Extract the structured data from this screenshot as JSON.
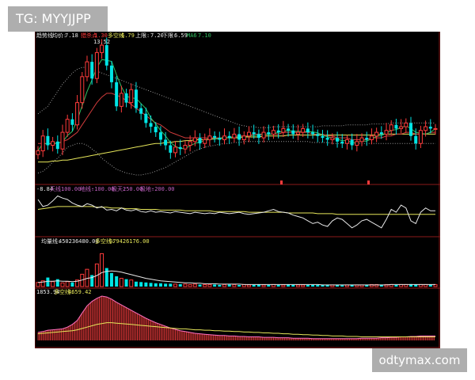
{
  "watermark_top": "TG: MYYJJPP",
  "watermark_bottom": "odtymax.com",
  "colors": {
    "up": "#ff3b3b",
    "down": "#00e5e5",
    "ma_white": "#e8e8e8",
    "ma_yellow": "#e6e65a",
    "ma_red": "#d23c3c",
    "ma_green": "#2fbf60",
    "dotted": "#9a9a9a",
    "grid_red": "#8b1a1a",
    "purple": "#c060c0",
    "orange": "#ffa500",
    "pink": "#ff70c0"
  },
  "chart_data": [
    {
      "type": "candlestick",
      "legend": {
        "title": "趋势线",
        "avg_label": "均价:",
        "avg_value": "7.18",
        "red_label": "猎杀点",
        "red_value": "1.30",
        "ls_label": "多空线",
        "ls_value": "6.79",
        "up_label": "上限:",
        "up_value": "7.20",
        "down_label": "下限:",
        "down_value": "6.59",
        "ma_label": "MA6",
        "ma_value": "7.10"
      },
      "peak_label": "13.52",
      "prices": [
        7.6,
        8.4,
        7.9,
        8.1,
        7.7,
        8.6,
        9.3,
        9.0,
        10.2,
        11.6,
        12.4,
        11.5,
        12.9,
        13.3,
        12.2,
        11.3,
        10.0,
        10.7,
        10.2,
        10.9,
        9.9,
        9.6,
        9.1,
        8.9,
        8.6,
        8.2,
        7.9,
        7.5,
        7.8,
        7.7,
        7.9,
        8.1,
        8.3,
        8.0,
        8.2,
        8.4,
        8.3,
        8.2,
        8.4,
        8.3,
        8.5,
        8.2,
        8.4,
        8.6,
        8.5,
        8.3,
        8.6,
        8.5,
        8.7,
        8.6,
        8.8,
        8.7,
        8.5,
        8.6,
        8.8,
        8.6,
        8.5,
        8.4,
        8.3,
        8.2,
        8.3,
        8.1,
        8.0,
        8.2,
        7.9,
        8.1,
        8.3,
        8.2,
        8.4,
        8.6,
        8.5,
        8.7,
        9.0,
        8.8,
        8.9,
        9.1,
        8.4,
        8.0,
        8.7,
        8.9,
        8.8,
        8.8
      ],
      "ma_red": [
        8.0,
        8.0,
        8.0,
        8.0,
        8.0,
        8.1,
        8.2,
        8.4,
        8.6,
        9.0,
        9.4,
        9.8,
        10.2,
        10.5,
        10.7,
        10.7,
        10.6,
        10.5,
        10.3,
        10.1,
        9.9,
        9.7,
        9.5,
        9.3,
        9.1,
        9.0,
        8.8,
        8.6,
        8.5,
        8.4,
        8.3,
        8.3,
        8.3,
        8.3,
        8.3,
        8.3,
        8.3,
        8.3,
        8.3,
        8.3,
        8.4,
        8.4,
        8.4,
        8.4,
        8.5,
        8.5,
        8.5,
        8.5,
        8.5,
        8.5,
        8.6,
        8.6,
        8.6,
        8.6,
        8.6,
        8.6,
        8.5,
        8.5,
        8.5,
        8.4,
        8.4,
        8.3,
        8.3,
        8.3,
        8.2,
        8.2,
        8.2,
        8.2,
        8.3,
        8.3,
        8.3,
        8.4,
        8.4,
        8.5,
        8.5,
        8.6,
        8.6,
        8.5,
        8.5,
        8.5,
        8.6,
        8.6
      ],
      "ma_yellow": [
        7.0,
        7.0,
        7.0,
        7.05,
        7.05,
        7.1,
        7.1,
        7.15,
        7.2,
        7.25,
        7.3,
        7.35,
        7.4,
        7.45,
        7.5,
        7.55,
        7.6,
        7.65,
        7.7,
        7.75,
        7.8,
        7.85,
        7.9,
        7.95,
        8.0,
        8.0,
        8.05,
        8.05,
        8.1,
        8.1,
        8.15,
        8.15,
        8.2,
        8.2,
        8.2,
        8.25,
        8.25,
        8.25,
        8.3,
        8.3,
        8.3,
        8.3,
        8.35,
        8.35,
        8.35,
        8.35,
        8.4,
        8.4,
        8.4,
        8.4,
        8.4,
        8.45,
        8.45,
        8.45,
        8.45,
        8.45,
        8.45,
        8.45,
        8.45,
        8.45,
        8.45,
        8.45,
        8.45,
        8.45,
        8.45,
        8.45,
        8.45,
        8.45,
        8.45,
        8.45,
        8.5,
        8.5,
        8.5,
        8.5,
        8.5,
        8.5,
        8.5,
        8.5,
        8.5,
        8.5,
        8.5,
        8.5
      ],
      "band_upper": [
        9.6,
        9.8,
        10.0,
        10.4,
        10.8,
        11.2,
        11.5,
        11.8,
        12.0,
        12.1,
        12.1,
        12.0,
        11.9,
        11.8,
        11.7,
        11.6,
        11.5,
        11.4,
        11.3,
        11.2,
        11.1,
        11.0,
        10.9,
        10.8,
        10.7,
        10.6,
        10.5,
        10.4,
        10.3,
        10.2,
        10.1,
        10.0,
        9.9,
        9.8,
        9.7,
        9.6,
        9.5,
        9.4,
        9.3,
        9.2,
        9.1,
        9.0,
        8.95,
        8.9,
        8.9,
        8.85,
        8.85,
        8.85,
        8.9,
        8.9,
        8.9,
        8.9,
        8.9,
        8.9,
        8.9,
        8.9,
        8.9,
        8.9,
        8.95,
        8.95,
        8.95,
        8.95,
        8.95,
        9.0,
        9.0,
        9.0,
        9.0,
        9.0,
        9.05,
        9.05,
        9.05,
        9.05,
        9.1,
        9.1,
        9.1,
        9.1,
        9.1,
        9.1,
        9.1,
        9.1,
        9.1,
        9.1
      ],
      "band_lower": [
        6.4,
        6.5,
        6.7,
        7.0,
        7.2,
        7.5,
        7.8,
        7.9,
        8.0,
        8.0,
        7.9,
        7.7,
        7.5,
        7.2,
        7.0,
        6.8,
        6.6,
        6.5,
        6.4,
        6.35,
        6.3,
        6.3,
        6.35,
        6.4,
        6.5,
        6.6,
        6.7,
        6.85,
        7.0,
        7.15,
        7.3,
        7.45,
        7.6,
        7.7,
        7.8,
        7.85,
        7.9,
        7.95,
        8.0,
        8.0,
        8.05,
        8.05,
        8.1,
        8.1,
        8.1,
        8.1,
        8.1,
        8.1,
        8.1,
        8.1,
        8.1,
        8.1,
        8.1,
        8.1,
        8.1,
        8.1,
        8.05,
        8.05,
        8.05,
        8.05,
        8.0,
        8.0,
        8.0,
        8.0,
        8.0,
        8.0,
        8.0,
        8.0,
        8.0,
        8.0,
        8.0,
        8.0,
        8.0,
        8.0,
        8.0,
        8.0,
        8.0,
        8.0,
        8.0,
        8.0,
        8.0,
        8.0
      ]
    },
    {
      "type": "line",
      "legend": {
        "value": "-8.84",
        "l1": "天线:",
        "v1": "100.00",
        "l2": "地线:",
        "v2": "-100.00",
        "l3": "极天:",
        "v3": "250.00",
        "l4": "极地:",
        "v4": "-200.00"
      },
      "white": [
        20,
        10,
        12,
        18,
        25,
        22,
        20,
        15,
        12,
        10,
        14,
        12,
        8,
        10,
        5,
        6,
        4,
        8,
        5,
        4,
        6,
        3,
        2,
        4,
        2,
        3,
        2,
        1,
        3,
        2,
        1,
        0,
        2,
        1,
        0,
        1,
        0,
        2,
        1,
        0,
        1,
        2,
        0,
        -1,
        0,
        1,
        2,
        4,
        6,
        3,
        2,
        1,
        -2,
        -4,
        -6,
        -10,
        -14,
        -12,
        -16,
        -18,
        -10,
        -6,
        -8,
        -14,
        -20,
        -16,
        -10,
        -8,
        -12,
        -16,
        -20,
        -8,
        6,
        2,
        12,
        8,
        -10,
        -14,
        2,
        8,
        4,
        4
      ],
      "yellow": [
        6,
        7,
        8,
        9,
        10,
        10,
        10,
        10,
        10,
        10,
        10,
        10,
        9,
        9,
        9,
        8,
        8,
        8,
        7,
        7,
        7,
        6,
        6,
        6,
        6,
        5,
        5,
        5,
        5,
        5,
        4,
        4,
        4,
        4,
        4,
        4,
        3,
        3,
        3,
        3,
        3,
        3,
        3,
        2,
        2,
        2,
        2,
        2,
        2,
        2,
        2,
        1,
        1,
        1,
        1,
        1,
        1,
        0,
        0,
        0,
        0,
        -1,
        -1,
        -1,
        -1,
        -1,
        -1,
        -1,
        -1,
        -1,
        -1,
        -1,
        -1,
        -1,
        -1,
        -1,
        -1,
        -1,
        -1,
        -1,
        -1,
        -1
      ]
    },
    {
      "type": "bar",
      "legend": {
        "label": "均量线:",
        "value": "450236480.00",
        "ls_label": "多空线:",
        "ls_value": "679426176.00"
      },
      "values": [
        0.1,
        0.14,
        0.22,
        0.12,
        0.18,
        0.09,
        0.12,
        0.1,
        0.16,
        0.3,
        0.42,
        0.28,
        0.55,
        0.8,
        0.45,
        0.33,
        0.25,
        0.2,
        0.18,
        0.16,
        0.12,
        0.11,
        0.1,
        0.09,
        0.08,
        0.08,
        0.07,
        0.07,
        0.06,
        0.06,
        0.06,
        0.05,
        0.06,
        0.05,
        0.05,
        0.05,
        0.05,
        0.04,
        0.05,
        0.05,
        0.05,
        0.04,
        0.05,
        0.04,
        0.04,
        0.05,
        0.04,
        0.04,
        0.05,
        0.04,
        0.04,
        0.05,
        0.04,
        0.04,
        0.04,
        0.04,
        0.04,
        0.04,
        0.04,
        0.04,
        0.04,
        0.04,
        0.03,
        0.04,
        0.04,
        0.04,
        0.04,
        0.04,
        0.05,
        0.05,
        0.04,
        0.05,
        0.05,
        0.04,
        0.05,
        0.05,
        0.06,
        0.05,
        0.05,
        0.05,
        0.05,
        0.05
      ],
      "ma": [
        0.1,
        0.11,
        0.13,
        0.13,
        0.14,
        0.13,
        0.13,
        0.12,
        0.13,
        0.16,
        0.2,
        0.22,
        0.27,
        0.34,
        0.37,
        0.38,
        0.37,
        0.35,
        0.32,
        0.29,
        0.26,
        0.23,
        0.2,
        0.18,
        0.16,
        0.14,
        0.13,
        0.12,
        0.11,
        0.1,
        0.09,
        0.09,
        0.08,
        0.08,
        0.07,
        0.07,
        0.07,
        0.06,
        0.06,
        0.06,
        0.06,
        0.06,
        0.05,
        0.05,
        0.05,
        0.05,
        0.05,
        0.05,
        0.05,
        0.05,
        0.05,
        0.05,
        0.05,
        0.05,
        0.05,
        0.05,
        0.05,
        0.05,
        0.04,
        0.04,
        0.04,
        0.04,
        0.04,
        0.04,
        0.04,
        0.04,
        0.04,
        0.04,
        0.04,
        0.04,
        0.04,
        0.04,
        0.05,
        0.05,
        0.05,
        0.05,
        0.05,
        0.05,
        0.05,
        0.05,
        0.05,
        0.05
      ]
    },
    {
      "type": "area",
      "legend": {
        "value": "1853.94",
        "ls_label": "多空线:",
        "ls_value": "4659.42"
      },
      "values": [
        0.18,
        0.2,
        0.23,
        0.24,
        0.25,
        0.26,
        0.3,
        0.36,
        0.45,
        0.62,
        0.78,
        0.88,
        0.95,
        1.0,
        0.98,
        0.93,
        0.86,
        0.8,
        0.74,
        0.68,
        0.62,
        0.56,
        0.5,
        0.45,
        0.4,
        0.36,
        0.32,
        0.28,
        0.25,
        0.22,
        0.2,
        0.18,
        0.16,
        0.15,
        0.14,
        0.13,
        0.12,
        0.11,
        0.11,
        0.1,
        0.1,
        0.09,
        0.09,
        0.08,
        0.08,
        0.08,
        0.07,
        0.07,
        0.07,
        0.06,
        0.06,
        0.06,
        0.05,
        0.05,
        0.05,
        0.05,
        0.04,
        0.04,
        0.04,
        0.04,
        0.04,
        0.04,
        0.04,
        0.04,
        0.04,
        0.04,
        0.05,
        0.05,
        0.05,
        0.05,
        0.06,
        0.06,
        0.07,
        0.07,
        0.08,
        0.08,
        0.09,
        0.09,
        0.1,
        0.1,
        0.1,
        0.1
      ],
      "yellow": [
        0.15,
        0.16,
        0.17,
        0.18,
        0.19,
        0.2,
        0.21,
        0.22,
        0.24,
        0.27,
        0.3,
        0.33,
        0.36,
        0.38,
        0.4,
        0.4,
        0.39,
        0.38,
        0.37,
        0.36,
        0.35,
        0.34,
        0.33,
        0.32,
        0.31,
        0.3,
        0.29,
        0.28,
        0.27,
        0.26,
        0.26,
        0.25,
        0.24,
        0.24,
        0.23,
        0.23,
        0.22,
        0.22,
        0.21,
        0.21,
        0.2,
        0.2,
        0.19,
        0.19,
        0.18,
        0.18,
        0.17,
        0.17,
        0.16,
        0.16,
        0.15,
        0.15,
        0.14,
        0.14,
        0.13,
        0.13,
        0.12,
        0.12,
        0.11,
        0.11,
        0.1,
        0.1,
        0.1,
        0.09,
        0.09,
        0.09,
        0.08,
        0.08,
        0.08,
        0.08,
        0.08,
        0.08,
        0.08,
        0.08,
        0.08,
        0.08,
        0.08,
        0.08,
        0.08,
        0.08,
        0.08,
        0.08
      ]
    }
  ]
}
